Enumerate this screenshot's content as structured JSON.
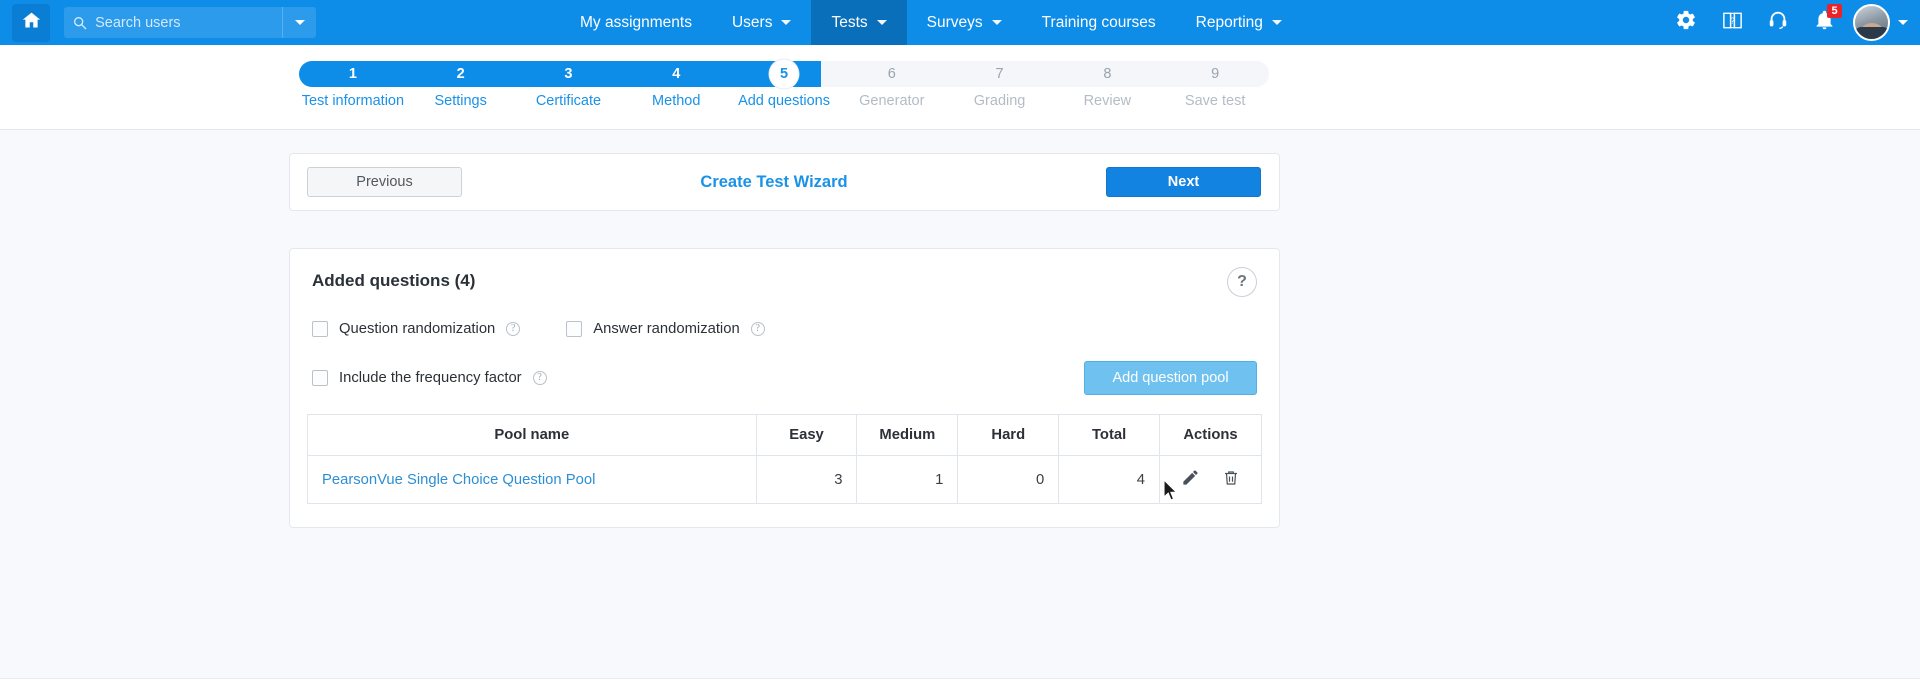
{
  "topnav": {
    "home_icon": "home-icon",
    "search": {
      "placeholder": "Search users",
      "value": "",
      "icon": "search-icon",
      "caret_icon": "chevron-down-icon"
    },
    "menu": [
      {
        "label": "My assignments",
        "has_caret": false,
        "active": false
      },
      {
        "label": "Users",
        "has_caret": true,
        "active": false
      },
      {
        "label": "Tests",
        "has_caret": true,
        "active": true
      },
      {
        "label": "Surveys",
        "has_caret": true,
        "active": false
      },
      {
        "label": "Training courses",
        "has_caret": false,
        "active": false
      },
      {
        "label": "Reporting",
        "has_caret": true,
        "active": false
      }
    ],
    "right_icons": [
      {
        "name": "gear-icon"
      },
      {
        "name": "help-book-icon"
      },
      {
        "name": "headset-support-icon"
      },
      {
        "name": "notification-bell-icon",
        "badge": "5"
      }
    ],
    "avatar": {
      "name": "user-avatar",
      "caret_icon": "chevron-down-icon"
    },
    "colors": {
      "bar": "#0d8ce8",
      "active_item": "#0a6fba",
      "badge": "#e8232a"
    }
  },
  "stepper": {
    "current_step": 5,
    "total_steps": 9,
    "steps": [
      {
        "num": "1",
        "label": "Test information",
        "state": "done"
      },
      {
        "num": "2",
        "label": "Settings",
        "state": "done"
      },
      {
        "num": "3",
        "label": "Certificate",
        "state": "done"
      },
      {
        "num": "4",
        "label": "Method",
        "state": "done"
      },
      {
        "num": "5",
        "label": "Add questions",
        "state": "current"
      },
      {
        "num": "6",
        "label": "Generator",
        "state": "upcoming"
      },
      {
        "num": "7",
        "label": "Grading",
        "state": "upcoming"
      },
      {
        "num": "8",
        "label": "Review",
        "state": "upcoming"
      },
      {
        "num": "9",
        "label": "Save test",
        "state": "upcoming"
      }
    ],
    "colors": {
      "fill": "#0d8ce8",
      "track": "#f4f6f9",
      "label_active": "#1a92e8",
      "label_inactive": "#b3bcc6"
    }
  },
  "wizard_bar": {
    "previous_label": "Previous",
    "title": "Create Test Wizard",
    "next_label": "Next"
  },
  "questions_panel": {
    "heading": "Added questions (4)",
    "help_icon_label": "?",
    "options": [
      {
        "label": "Question randomization",
        "checked": false,
        "help": "?"
      },
      {
        "label": "Answer randomization",
        "checked": false,
        "help": "?"
      },
      {
        "label": "Include the frequency factor",
        "checked": false,
        "help": "?"
      }
    ],
    "add_pool_button": "Add question pool",
    "table": {
      "headers": [
        "Pool name",
        "Easy",
        "Medium",
        "Hard",
        "Total",
        "Actions"
      ],
      "rows": [
        {
          "pool_name": "PearsonVue Single Choice Question Pool",
          "easy": "3",
          "medium": "1",
          "hard": "0",
          "total": "4",
          "actions": [
            "edit-pencil-icon",
            "delete-trash-icon"
          ]
        }
      ]
    }
  }
}
